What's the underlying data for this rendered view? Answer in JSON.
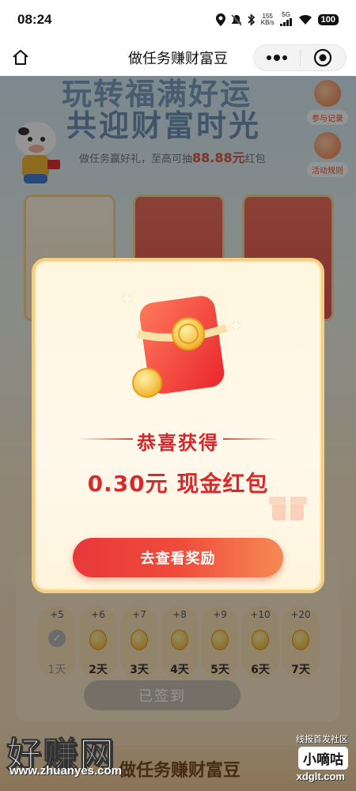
{
  "status_bar": {
    "time": "08:24",
    "speed_value": "155",
    "speed_unit": "KB/s",
    "network": "5G",
    "battery": "100",
    "icons": [
      "location-icon",
      "mute-icon",
      "bluetooth-icon",
      "signal-icon",
      "wifi-icon",
      "battery-icon"
    ]
  },
  "nav": {
    "title": "做任务赚财富豆",
    "home_icon": "home-icon",
    "more_icon": "more-icon",
    "close_icon": "target-close-icon"
  },
  "background": {
    "hero_line1": "玩转福满好运",
    "hero_line2": "共迎财富时光",
    "hero_sub_prefix": "做任务赢好礼，至高可抽",
    "hero_sub_amount": "88.88元",
    "hero_sub_suffix": "红包",
    "side_buttons": [
      {
        "label": "参与记录"
      },
      {
        "label": "活动规则"
      }
    ],
    "checkin_days": [
      {
        "plus": "+5",
        "label": "1天",
        "signed": true
      },
      {
        "plus": "+6",
        "label": "2天",
        "signed": false
      },
      {
        "plus": "+7",
        "label": "3天",
        "signed": false
      },
      {
        "plus": "+8",
        "label": "4天",
        "signed": false
      },
      {
        "plus": "+9",
        "label": "5天",
        "signed": false
      },
      {
        "plus": "+10",
        "label": "6天",
        "signed": false
      },
      {
        "plus": "+20",
        "label": "7天",
        "signed": false
      }
    ],
    "signed_button": "已签到",
    "bottom_title": "做任务赚财富豆"
  },
  "modal": {
    "congrats": "恭喜获得",
    "reward": "0.30元 现金红包",
    "cta": "去查看奖励"
  },
  "watermark": {
    "left_main": "好赚网",
    "left_url": "www.zhuanyes.com",
    "right_top": "线报首发社区",
    "right_mid": "小嘀咕",
    "right_bottom": "xdglt.com"
  },
  "colors": {
    "accent_red": "#d62a2d",
    "cta_start": "#e8383b",
    "cta_end": "#f58a55",
    "modal_border": "#f3cf86"
  }
}
